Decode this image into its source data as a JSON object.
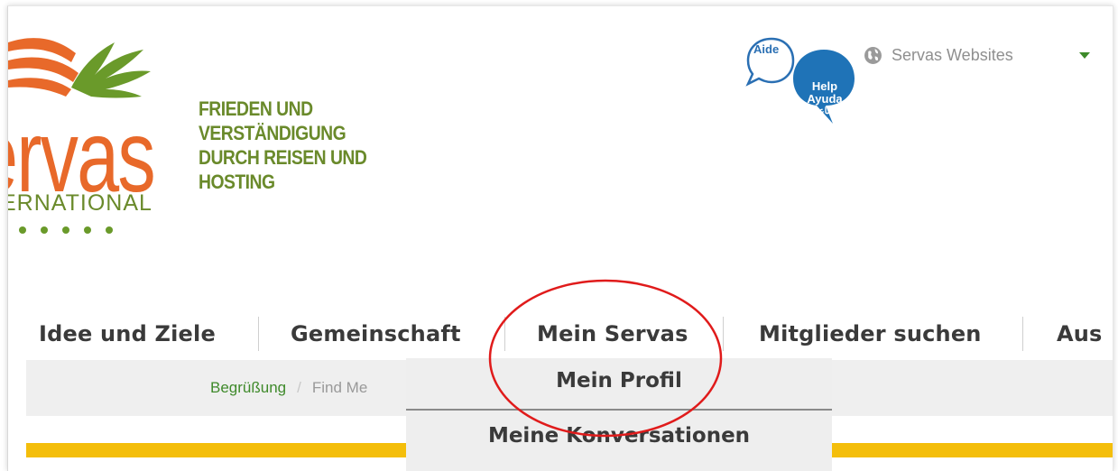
{
  "brand": {
    "tagline_lines": [
      "FRIEDEN UND",
      "VERSTÄNDIGUNG",
      "DURCH REISEN UND",
      "HOSTING"
    ],
    "logo_wordmark": "ervas",
    "logo_subtext": "ERNATIONAL",
    "colors": {
      "green": "#6a8a2b",
      "orange": "#e8692a",
      "dots": "#6a9a2a"
    }
  },
  "help": {
    "aide_label": "Aide",
    "lines": [
      "Help",
      "Ayuda",
      "مساعدة"
    ],
    "bubble_color": "#1f73b7"
  },
  "websites": {
    "label": "Servas Websites",
    "icon": "globe-icon"
  },
  "nav": {
    "items": [
      "Idee und Ziele",
      "Gemeinschaft",
      "Mein Servas",
      "Mitglieder suchen",
      "Aus"
    ]
  },
  "breadcrumb": {
    "home": "Begrüßung",
    "current": "Find Me"
  },
  "dropdown": {
    "items": [
      "Mein Profil",
      "Meine Konversationen"
    ]
  },
  "accent": {
    "yellow": "#f4be0b",
    "annotation_red": "#e01b1b"
  }
}
